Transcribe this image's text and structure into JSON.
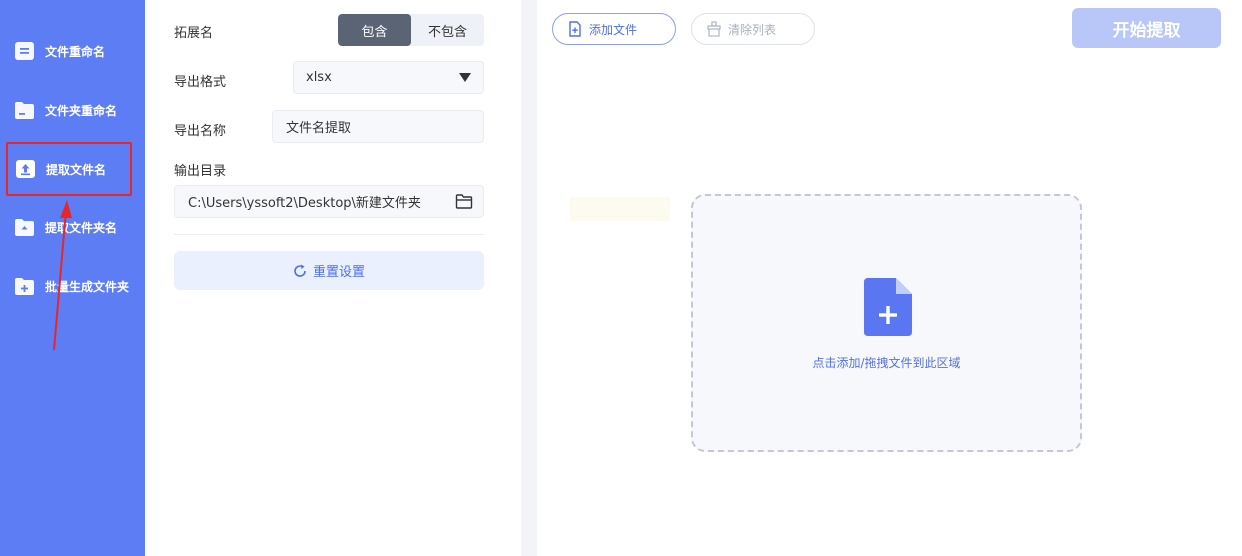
{
  "sidebar": {
    "items": [
      {
        "label": "文件重命名",
        "icon": "document-icon"
      },
      {
        "label": "文件夹重命名",
        "icon": "folder-icon"
      },
      {
        "label": "提取文件名",
        "icon": "upload-icon",
        "active": true
      },
      {
        "label": "提取文件夹名",
        "icon": "folder-up-icon"
      },
      {
        "label": "批量生成文件夹",
        "icon": "folder-add-icon"
      }
    ]
  },
  "settings": {
    "extension": {
      "label": "拓展名",
      "options": [
        "包含",
        "不包含"
      ],
      "selected": "包含"
    },
    "format": {
      "label": "导出格式",
      "value": "xlsx"
    },
    "name": {
      "label": "导出名称",
      "value": "文件名提取"
    },
    "output_dir": {
      "label": "输出目录",
      "value": "C:\\Users\\yssoft2\\Desktop\\新建文件夹"
    },
    "reset_label": "重置设置"
  },
  "toolbar": {
    "add_label": "添加文件",
    "clear_label": "清除列表",
    "start_label": "开始提取"
  },
  "dropzone": {
    "hint": "点击添加/拖拽文件到此区域"
  },
  "colors": {
    "sidebar": "#5d7df4",
    "accent": "#4d6ff2",
    "highlight": "#e8262a",
    "start_disabled": "#b8c7f8"
  }
}
